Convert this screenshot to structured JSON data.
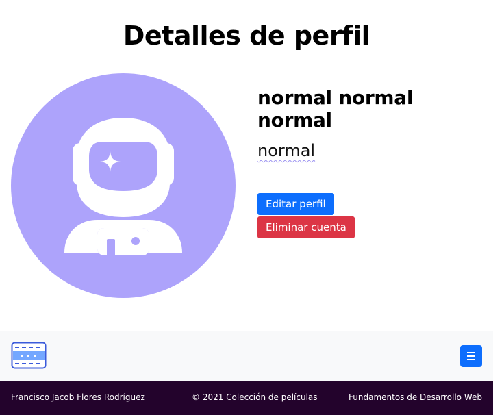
{
  "header": {
    "title": "Detalles de perfil"
  },
  "profile": {
    "avatar_icon": "astronaut-icon",
    "avatar_color": "#ada3fb",
    "full_name": "normal normal normal",
    "role": "normal"
  },
  "actions": {
    "edit_label": "Editar perfil",
    "delete_label": "Eliminar cuenta",
    "edit_color": "#0d6efd",
    "delete_color": "#dc3545"
  },
  "navbar": {
    "brand_icon": "film-strip-icon",
    "menu_icon": "hamburger-menu-icon"
  },
  "footer": {
    "author": "Francisco Jacob Flores Rodríguez",
    "copyright": "© 2021 Colección de películas",
    "course": "Fundamentos de Desarrollo Web",
    "background": "#23032c"
  }
}
